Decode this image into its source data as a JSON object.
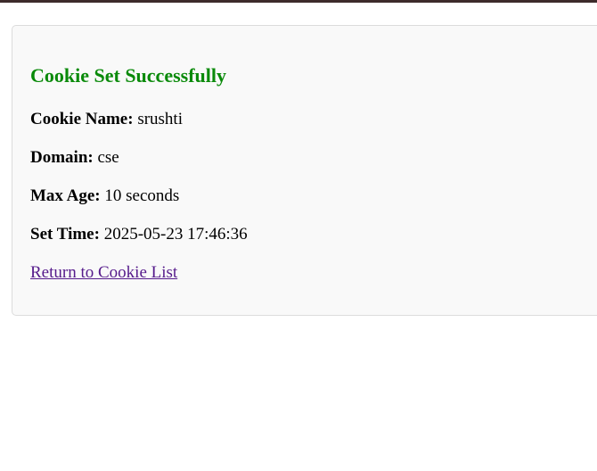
{
  "colors": {
    "title": "#0a8a0a",
    "link_visited": "#551a8b",
    "card_background": "#f9f9f9",
    "card_border": "#dcdcdc",
    "top_bar": "#3d2b2b"
  },
  "card": {
    "title": "Cookie Set Successfully",
    "fields": [
      {
        "label": "Cookie Name:",
        "value": "srushti"
      },
      {
        "label": "Domain:",
        "value": "cse"
      },
      {
        "label": "Max Age:",
        "value": "10 seconds"
      },
      {
        "label": "Set Time:",
        "value": "2025-05-23 17:46:36"
      }
    ],
    "return_link": "Return to Cookie List"
  }
}
